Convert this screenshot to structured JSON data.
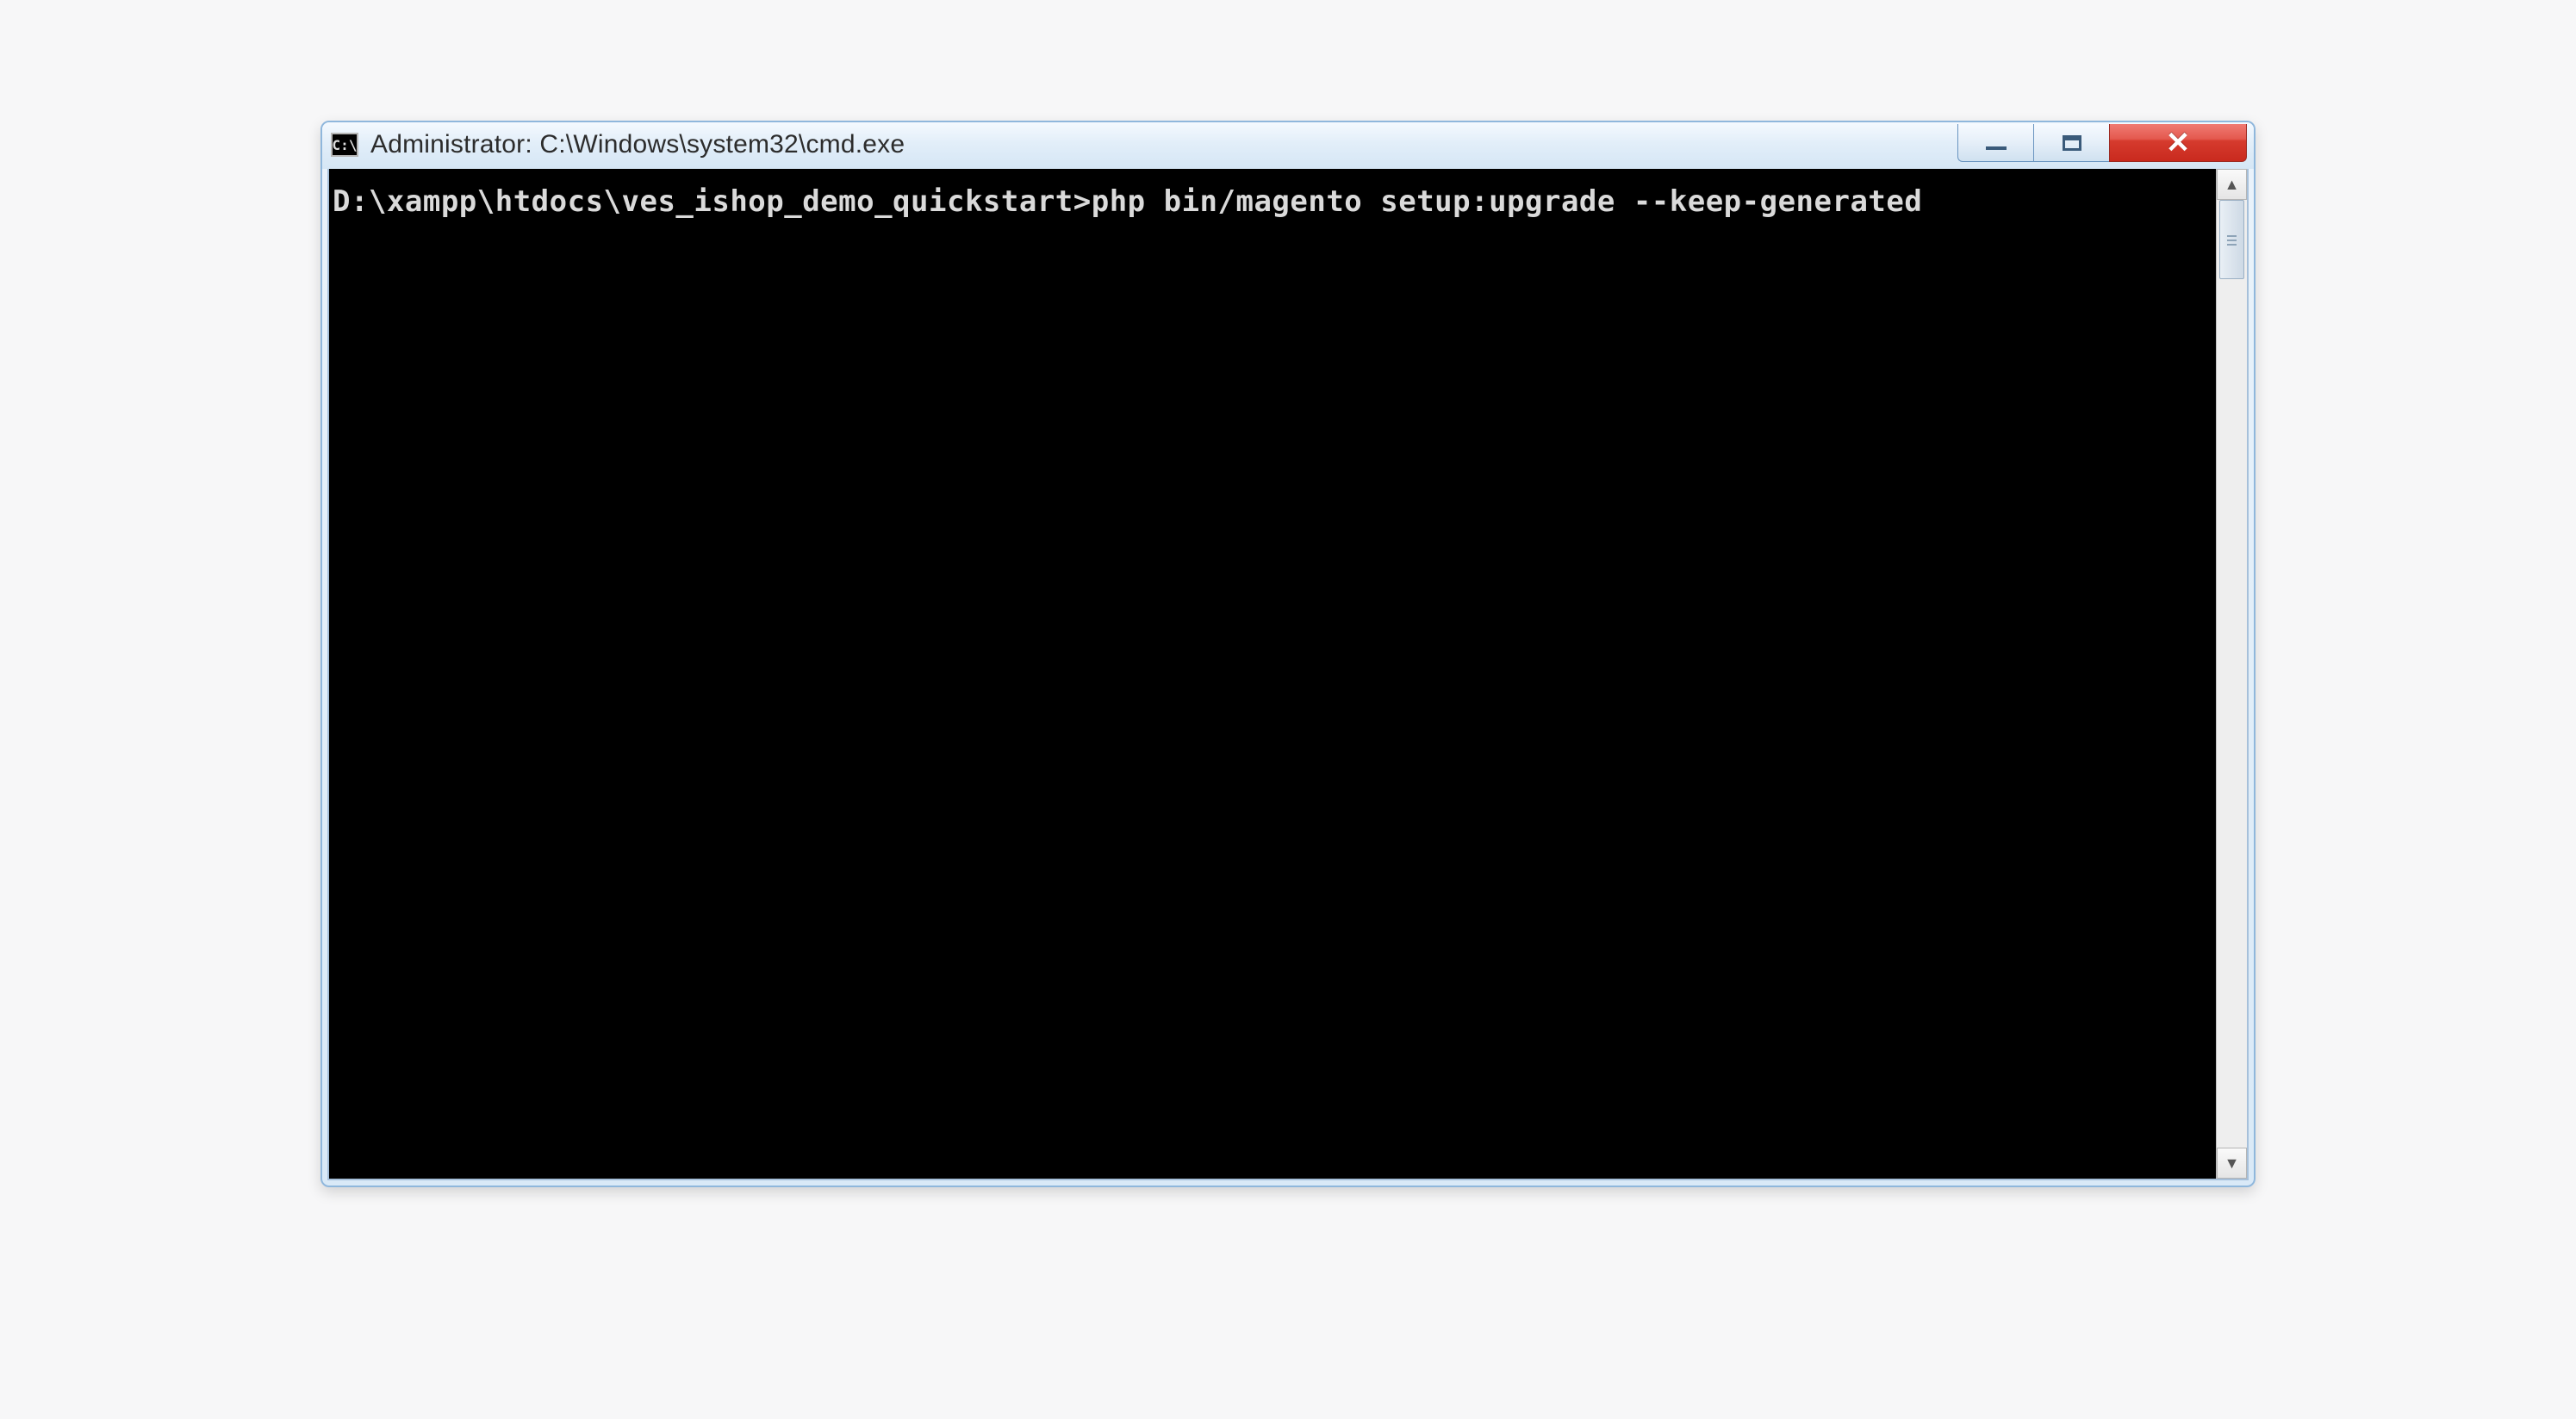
{
  "window": {
    "icon_label": "C:\\",
    "title": "Administrator: C:\\Windows\\system32\\cmd.exe"
  },
  "controls": {
    "minimize": "minimize",
    "maximize": "maximize",
    "close": "close"
  },
  "terminal": {
    "prompt": "D:\\xampp\\htdocs\\ves_ishop_demo_quickstart>",
    "command": "php bin/magento setup:upgrade --keep-generated"
  }
}
